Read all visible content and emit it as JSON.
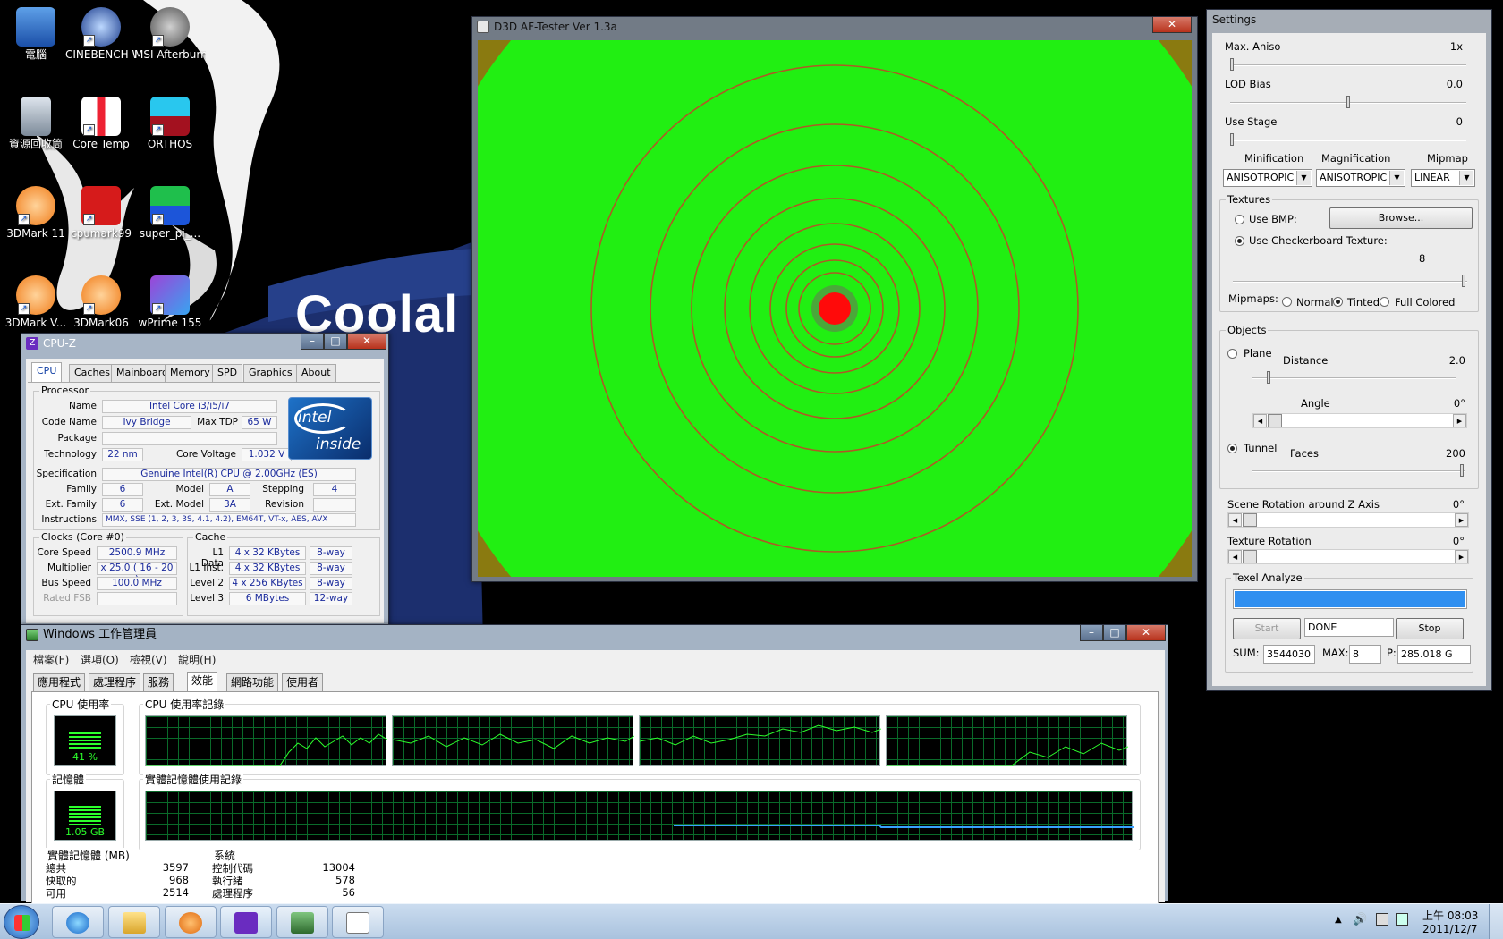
{
  "desktop": {
    "banner_text": "Coolal",
    "icons": [
      {
        "label": "電腦",
        "icon": "computer-icon"
      },
      {
        "label": "CINEBENCH Windows ...",
        "icon": "cinebench-icon"
      },
      {
        "label": "MSI Afterburner",
        "icon": "afterburner-icon"
      },
      {
        "label": "資源回收筒",
        "icon": "recycle-bin-icon"
      },
      {
        "label": "Core Temp",
        "icon": "core-temp-icon"
      },
      {
        "label": "ORTHOS",
        "icon": "orthos-icon"
      },
      {
        "label": "3DMark 11",
        "icon": "3dmark-icon"
      },
      {
        "label": "cpumark99",
        "icon": "cpumark-icon"
      },
      {
        "label": "super_pi_...",
        "icon": "superpi-icon"
      },
      {
        "label": "3DMark V...",
        "icon": "3dmark-icon"
      },
      {
        "label": "3DMark06",
        "icon": "3dmark06-icon"
      },
      {
        "label": "wPrime 155",
        "icon": "wprime-icon"
      }
    ]
  },
  "aftester": {
    "title": "D3D AF-Tester Ver 1.3a",
    "close": "✕"
  },
  "settings": {
    "title": "Settings",
    "max_aniso_label": "Max. Aniso",
    "max_aniso_value": "1x",
    "lod_bias_label": "LOD Bias",
    "lod_bias_value": "0.0",
    "use_stage_label": "Use Stage",
    "use_stage_value": "0",
    "minification_label": "Minification",
    "magnification_label": "Magnification",
    "mipmap_label": "Mipmap",
    "minification_value": "ANISOTROPIC",
    "magnification_value": "ANISOTROPIC",
    "mipmap_value": "LINEAR",
    "textures_label": "Textures",
    "use_bmp_label": "Use BMP:",
    "browse_label": "Browse...",
    "checker_label": "Use Checkerboard Texture:",
    "checker_value": "8",
    "mipmaps_label": "Mipmaps:",
    "normal_label": "Normal",
    "tinted_label": "Tinted",
    "full_colored_label": "Full Colored",
    "objects_label": "Objects",
    "plane_label": "Plane",
    "distance_label": "Distance",
    "distance_value": "2.0",
    "angle_label": "Angle",
    "angle_value": "0°",
    "tunnel_label": "Tunnel",
    "faces_label": "Faces",
    "faces_value": "200",
    "scene_rot_label": "Scene Rotation around Z Axis",
    "scene_rot_value": "0°",
    "tex_rot_label": "Texture Rotation",
    "tex_rot_value": "0°",
    "texel_label": "Texel Analyze",
    "texel_progress": 1.0,
    "start_label": "Start",
    "status_value": "DONE",
    "stop_label": "Stop",
    "sum_label": "SUM:",
    "sum_value": "3544030",
    "max_label": "MAX:",
    "max_value": "8",
    "p_label": "P:",
    "p_value": "285.018 G"
  },
  "cpuz": {
    "title": "CPU-Z",
    "tabs": [
      "CPU",
      "Caches",
      "Mainboard",
      "Memory",
      "SPD",
      "Graphics",
      "About"
    ],
    "processor_label": "Processor",
    "name_label": "Name",
    "name_value": "Intel Core i3/i5/i7",
    "codename_label": "Code Name",
    "codename_value": "Ivy Bridge",
    "maxtdp_label": "Max TDP",
    "maxtdp_value": "65 W",
    "package_label": "Package",
    "technology_label": "Technology",
    "technology_value": "22 nm",
    "voltage_label": "Core Voltage",
    "voltage_value": "1.032 V",
    "spec_label": "Specification",
    "spec_value": "Genuine Intel(R) CPU  @ 2.00GHz (ES)",
    "family_label": "Family",
    "family_value": "6",
    "model_label": "Model",
    "model_value": "A",
    "stepping_label": "Stepping",
    "stepping_value": "4",
    "extfamily_label": "Ext. Family",
    "extfamily_value": "6",
    "extmodel_label": "Ext. Model",
    "extmodel_value": "3A",
    "revision_label": "Revision",
    "instructions_label": "Instructions",
    "instructions_value": "MMX, SSE (1, 2, 3, 3S, 4.1, 4.2), EM64T, VT-x, AES, AVX",
    "clocks_label": "Clocks (Core #0)",
    "corespeed_label": "Core Speed",
    "corespeed_value": "2500.9 MHz",
    "multiplier_label": "Multiplier",
    "multiplier_value": "x 25.0 ( 16 - 20 )",
    "busspeed_label": "Bus Speed",
    "busspeed_value": "100.0 MHz",
    "ratedfsb_label": "Rated FSB",
    "cache_label": "Cache",
    "cache_rows": [
      {
        "label": "L1 Data",
        "size": "4 x 32 KBytes",
        "way": "8-way"
      },
      {
        "label": "L1 Inst.",
        "size": "4 x 32 KBytes",
        "way": "8-way"
      },
      {
        "label": "Level 2",
        "size": "4 x 256 KBytes",
        "way": "8-way"
      },
      {
        "label": "Level 3",
        "size": "6 MBytes",
        "way": "12-way"
      }
    ],
    "intel_word": "intel",
    "intel_inside": "inside"
  },
  "taskmgr": {
    "title": "Windows 工作管理員",
    "menu": [
      "檔案(F)",
      "選項(O)",
      "檢視(V)",
      "說明(H)"
    ],
    "tabs": [
      "應用程式",
      "處理程序",
      "服務",
      "效能",
      "網路功能",
      "使用者"
    ],
    "cpu_usage_label": "CPU 使用率",
    "cpu_usage_value": "41 %",
    "cpu_usage_level": 0.41,
    "cpu_history_label": "CPU 使用率記錄",
    "memory_label": "記憶體",
    "memory_value": "1.05 GB",
    "mem_history_label": "實體記憶體使用記錄",
    "physical_label": "實體記憶體 (MB)",
    "physical_rows": [
      {
        "k": "總共",
        "v": "3597"
      },
      {
        "k": "快取的",
        "v": "968"
      },
      {
        "k": "可用",
        "v": "2514"
      }
    ],
    "system_label": "系統",
    "system_rows": [
      {
        "k": "控制代碼",
        "v": "13004"
      },
      {
        "k": "執行緒",
        "v": "578"
      },
      {
        "k": "處理程序",
        "v": "56"
      }
    ]
  },
  "taskbar": {
    "clock_time": "上午 08:03",
    "clock_date": "2011/12/7",
    "apps": [
      "explorer-icon",
      "ie-icon",
      "folder-icon",
      "media-player-icon",
      "cpuz-icon",
      "gpu-z-icon",
      "notepad-icon"
    ]
  },
  "colors": {
    "af_green": "#21ef12",
    "af_edge": "#8a7a10",
    "af_center": "#ff0a0a",
    "graph_line": "#2cff2c",
    "progress": "#2f8ff0"
  }
}
